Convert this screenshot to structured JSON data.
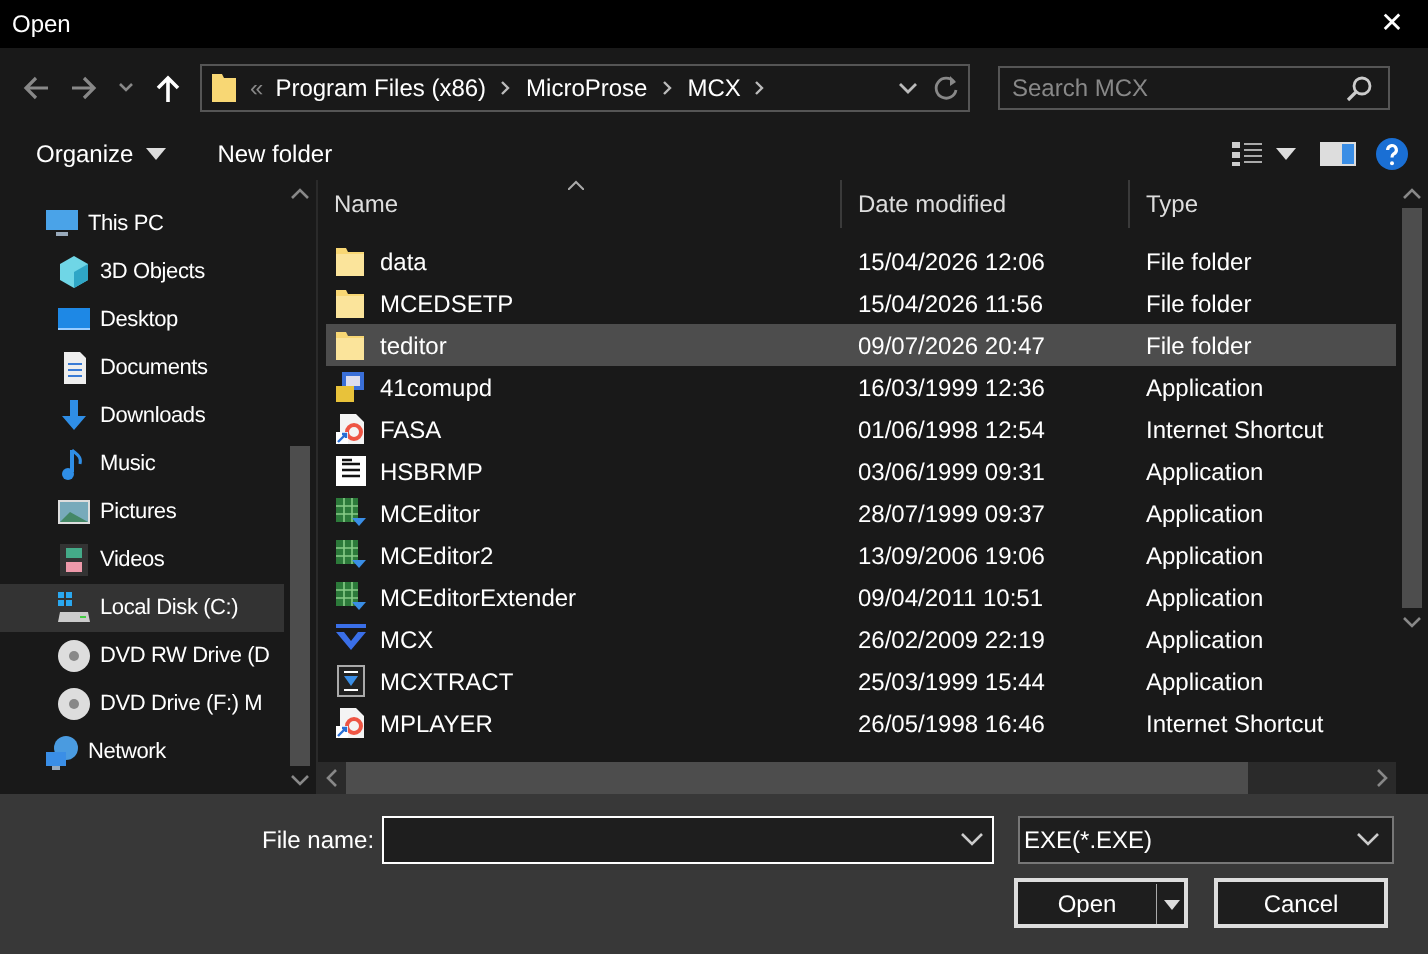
{
  "window": {
    "title": "Open",
    "close": "✕"
  },
  "nav": {
    "path": [
      "Program Files (x86)",
      "MicroProse",
      "MCX"
    ],
    "overflow": "«",
    "search": {
      "placeholder": "Search MCX"
    }
  },
  "toolbar": {
    "organize": "Organize",
    "new_folder": "New folder"
  },
  "sidebar": {
    "items": [
      {
        "label": "This PC",
        "kind": "pc",
        "selected": false,
        "children": [
          {
            "label": "3D Objects",
            "kind": "cube",
            "selected": false
          },
          {
            "label": "Desktop",
            "kind": "desktop",
            "selected": false
          },
          {
            "label": "Documents",
            "kind": "documents",
            "selected": false
          },
          {
            "label": "Downloads",
            "kind": "downloads",
            "selected": false
          },
          {
            "label": "Music",
            "kind": "music",
            "selected": false
          },
          {
            "label": "Pictures",
            "kind": "pictures",
            "selected": false
          },
          {
            "label": "Videos",
            "kind": "videos",
            "selected": false
          },
          {
            "label": "Local Disk (C:)",
            "kind": "disk",
            "selected": true
          },
          {
            "label": "DVD RW Drive (D",
            "kind": "dvd",
            "selected": false
          },
          {
            "label": "DVD Drive (F:) M",
            "kind": "dvd",
            "selected": false
          }
        ]
      },
      {
        "label": "Network",
        "kind": "network",
        "selected": false
      }
    ]
  },
  "table": {
    "columns": [
      "Name",
      "Date modified",
      "Type"
    ],
    "rows": [
      {
        "name": "data",
        "date": "15/04/2026 12:06",
        "type": "File folder",
        "kind": "folder",
        "selected": false
      },
      {
        "name": "MCEDSETP",
        "date": "15/04/2026 11:56",
        "type": "File folder",
        "kind": "folder",
        "selected": false
      },
      {
        "name": "teditor",
        "date": "09/07/2026 20:47",
        "type": "File folder",
        "kind": "folder",
        "selected": true
      },
      {
        "name": "41comupd",
        "date": "16/03/1999 12:36",
        "type": "Application",
        "kind": "setup",
        "selected": false
      },
      {
        "name": "FASA",
        "date": "01/06/1998 12:54",
        "type": "Internet Shortcut",
        "kind": "shortcut",
        "selected": false
      },
      {
        "name": "HSBRMP",
        "date": "03/06/1999 09:31",
        "type": "Application",
        "kind": "document",
        "selected": false
      },
      {
        "name": "MCEditor",
        "date": "28/07/1999 09:37",
        "type": "Application",
        "kind": "editor",
        "selected": false
      },
      {
        "name": "MCEditor2",
        "date": "13/09/2006 19:06",
        "type": "Application",
        "kind": "editor",
        "selected": false
      },
      {
        "name": "MCEditorExtender",
        "date": "09/04/2011 10:51",
        "type": "Application",
        "kind": "editor",
        "selected": false
      },
      {
        "name": "MCX",
        "date": "26/02/2009 22:19",
        "type": "Application",
        "kind": "chevron",
        "selected": false
      },
      {
        "name": "MCXTRACT",
        "date": "25/03/1999 15:44",
        "type": "Application",
        "kind": "extract",
        "selected": false
      },
      {
        "name": "MPLAYER",
        "date": "26/05/1998 16:46",
        "type": "Internet Shortcut",
        "kind": "shortcut",
        "selected": false
      }
    ]
  },
  "footer": {
    "file_name_label": "File name:",
    "filter": "EXE(*.EXE)",
    "open": "Open",
    "cancel": "Cancel"
  }
}
